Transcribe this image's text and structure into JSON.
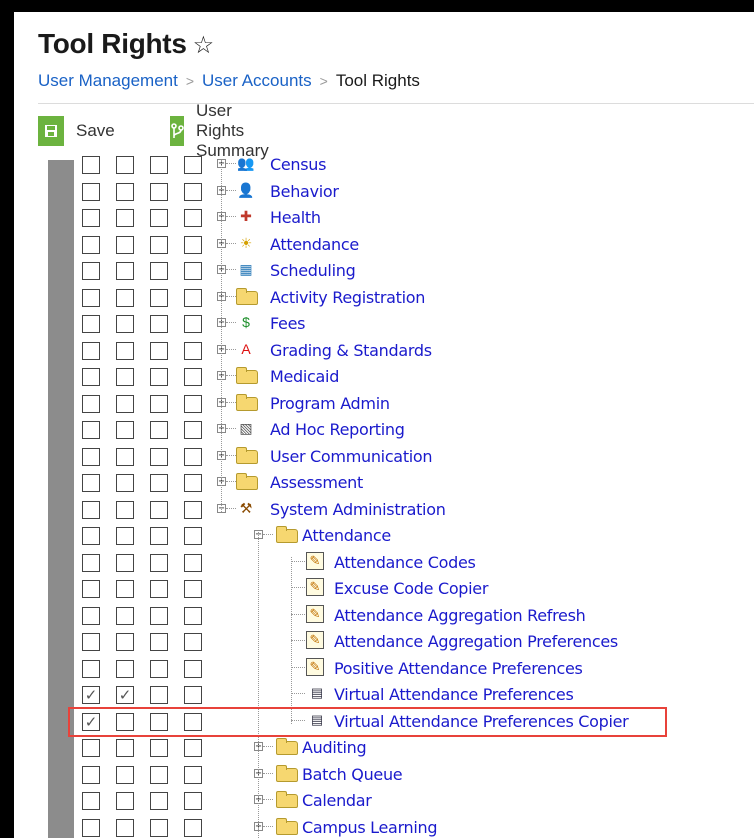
{
  "page": {
    "title": "Tool Rights",
    "star": "☆"
  },
  "breadcrumb": {
    "item1": "User Management",
    "item2": "User Accounts",
    "current": "Tool Rights",
    "sep": ">"
  },
  "toolbar": {
    "save_label": "Save",
    "summary_label": "User Rights Summary",
    "save_icon": "save-icon",
    "summary_icon": "branch-icon"
  },
  "rows": [
    {
      "label": "Census",
      "level": 0,
      "toggle": "+",
      "icon": "census-icon",
      "checks": [
        false,
        false,
        false,
        false
      ]
    },
    {
      "label": "Behavior",
      "level": 0,
      "toggle": "+",
      "icon": "behavior-icon",
      "checks": [
        false,
        false,
        false,
        false
      ]
    },
    {
      "label": "Health",
      "level": 0,
      "toggle": "+",
      "icon": "health-icon",
      "checks": [
        false,
        false,
        false,
        false
      ]
    },
    {
      "label": "Attendance",
      "level": 0,
      "toggle": "+",
      "icon": "attendance-icon",
      "checks": [
        false,
        false,
        false,
        false
      ]
    },
    {
      "label": "Scheduling",
      "level": 0,
      "toggle": "+",
      "icon": "scheduling-icon",
      "checks": [
        false,
        false,
        false,
        false
      ]
    },
    {
      "label": "Activity Registration",
      "level": 0,
      "toggle": "+",
      "icon": "folder-icon",
      "checks": [
        false,
        false,
        false,
        false
      ]
    },
    {
      "label": "Fees",
      "level": 0,
      "toggle": "+",
      "icon": "fees-icon",
      "checks": [
        false,
        false,
        false,
        false
      ]
    },
    {
      "label": "Grading & Standards",
      "level": 0,
      "toggle": "+",
      "icon": "grading-icon",
      "checks": [
        false,
        false,
        false,
        false
      ]
    },
    {
      "label": "Medicaid",
      "level": 0,
      "toggle": "+",
      "icon": "folder-icon",
      "checks": [
        false,
        false,
        false,
        false
      ]
    },
    {
      "label": "Program Admin",
      "level": 0,
      "toggle": "+",
      "icon": "folder-icon",
      "checks": [
        false,
        false,
        false,
        false
      ]
    },
    {
      "label": "Ad Hoc Reporting",
      "level": 0,
      "toggle": "+",
      "icon": "adhoc-icon",
      "checks": [
        false,
        false,
        false,
        false
      ]
    },
    {
      "label": "User Communication",
      "level": 0,
      "toggle": "+",
      "icon": "folder-icon",
      "checks": [
        false,
        false,
        false,
        false
      ]
    },
    {
      "label": "Assessment",
      "level": 0,
      "toggle": "+",
      "icon": "folder-icon",
      "checks": [
        false,
        false,
        false,
        false
      ]
    },
    {
      "label": "System Administration",
      "level": 0,
      "toggle": "-",
      "icon": "sysadmin-icon",
      "checks": [
        false,
        false,
        false,
        false
      ]
    },
    {
      "label": "Attendance",
      "level": 1,
      "toggle": "-",
      "icon": "folder-icon",
      "checks": [
        false,
        false,
        false,
        false
      ]
    },
    {
      "label": "Attendance Codes",
      "level": 2,
      "toggle": "",
      "icon": "tool-icon",
      "checks": [
        false,
        false,
        false,
        false
      ]
    },
    {
      "label": "Excuse Code Copier",
      "level": 2,
      "toggle": "",
      "icon": "tool-icon",
      "checks": [
        false,
        false,
        false,
        false
      ]
    },
    {
      "label": "Attendance Aggregation Refresh",
      "level": 2,
      "toggle": "",
      "icon": "tool-icon",
      "checks": [
        false,
        false,
        false,
        false
      ]
    },
    {
      "label": "Attendance Aggregation Preferences",
      "level": 2,
      "toggle": "",
      "icon": "tool-icon",
      "checks": [
        false,
        false,
        false,
        false
      ]
    },
    {
      "label": "Positive Attendance Preferences",
      "level": 2,
      "toggle": "",
      "icon": "tool-icon",
      "checks": [
        false,
        false,
        false,
        false
      ]
    },
    {
      "label": "Virtual Attendance Preferences",
      "level": 2,
      "toggle": "",
      "icon": "window-icon",
      "checks": [
        true,
        true,
        false,
        false
      ]
    },
    {
      "label": "Virtual Attendance Preferences Copier",
      "level": 2,
      "toggle": "",
      "icon": "window-icon",
      "checks": [
        true,
        false,
        false,
        false
      ]
    },
    {
      "label": "Auditing",
      "level": 1,
      "toggle": "+",
      "icon": "folder-icon",
      "checks": [
        false,
        false,
        false,
        false
      ]
    },
    {
      "label": "Batch Queue",
      "level": 1,
      "toggle": "+",
      "icon": "folder-icon",
      "checks": [
        false,
        false,
        false,
        false
      ]
    },
    {
      "label": "Calendar",
      "level": 1,
      "toggle": "+",
      "icon": "folder-icon",
      "checks": [
        false,
        false,
        false,
        false
      ]
    },
    {
      "label": "Campus Learning",
      "level": 1,
      "toggle": "+",
      "icon": "folder-icon",
      "checks": [
        false,
        false,
        false,
        false
      ]
    }
  ],
  "colors": {
    "accent_green": "#6cb33f",
    "link_blue": "#1a62c6",
    "tree_blue": "#1a1acc",
    "highlight_red": "#e8423a"
  }
}
